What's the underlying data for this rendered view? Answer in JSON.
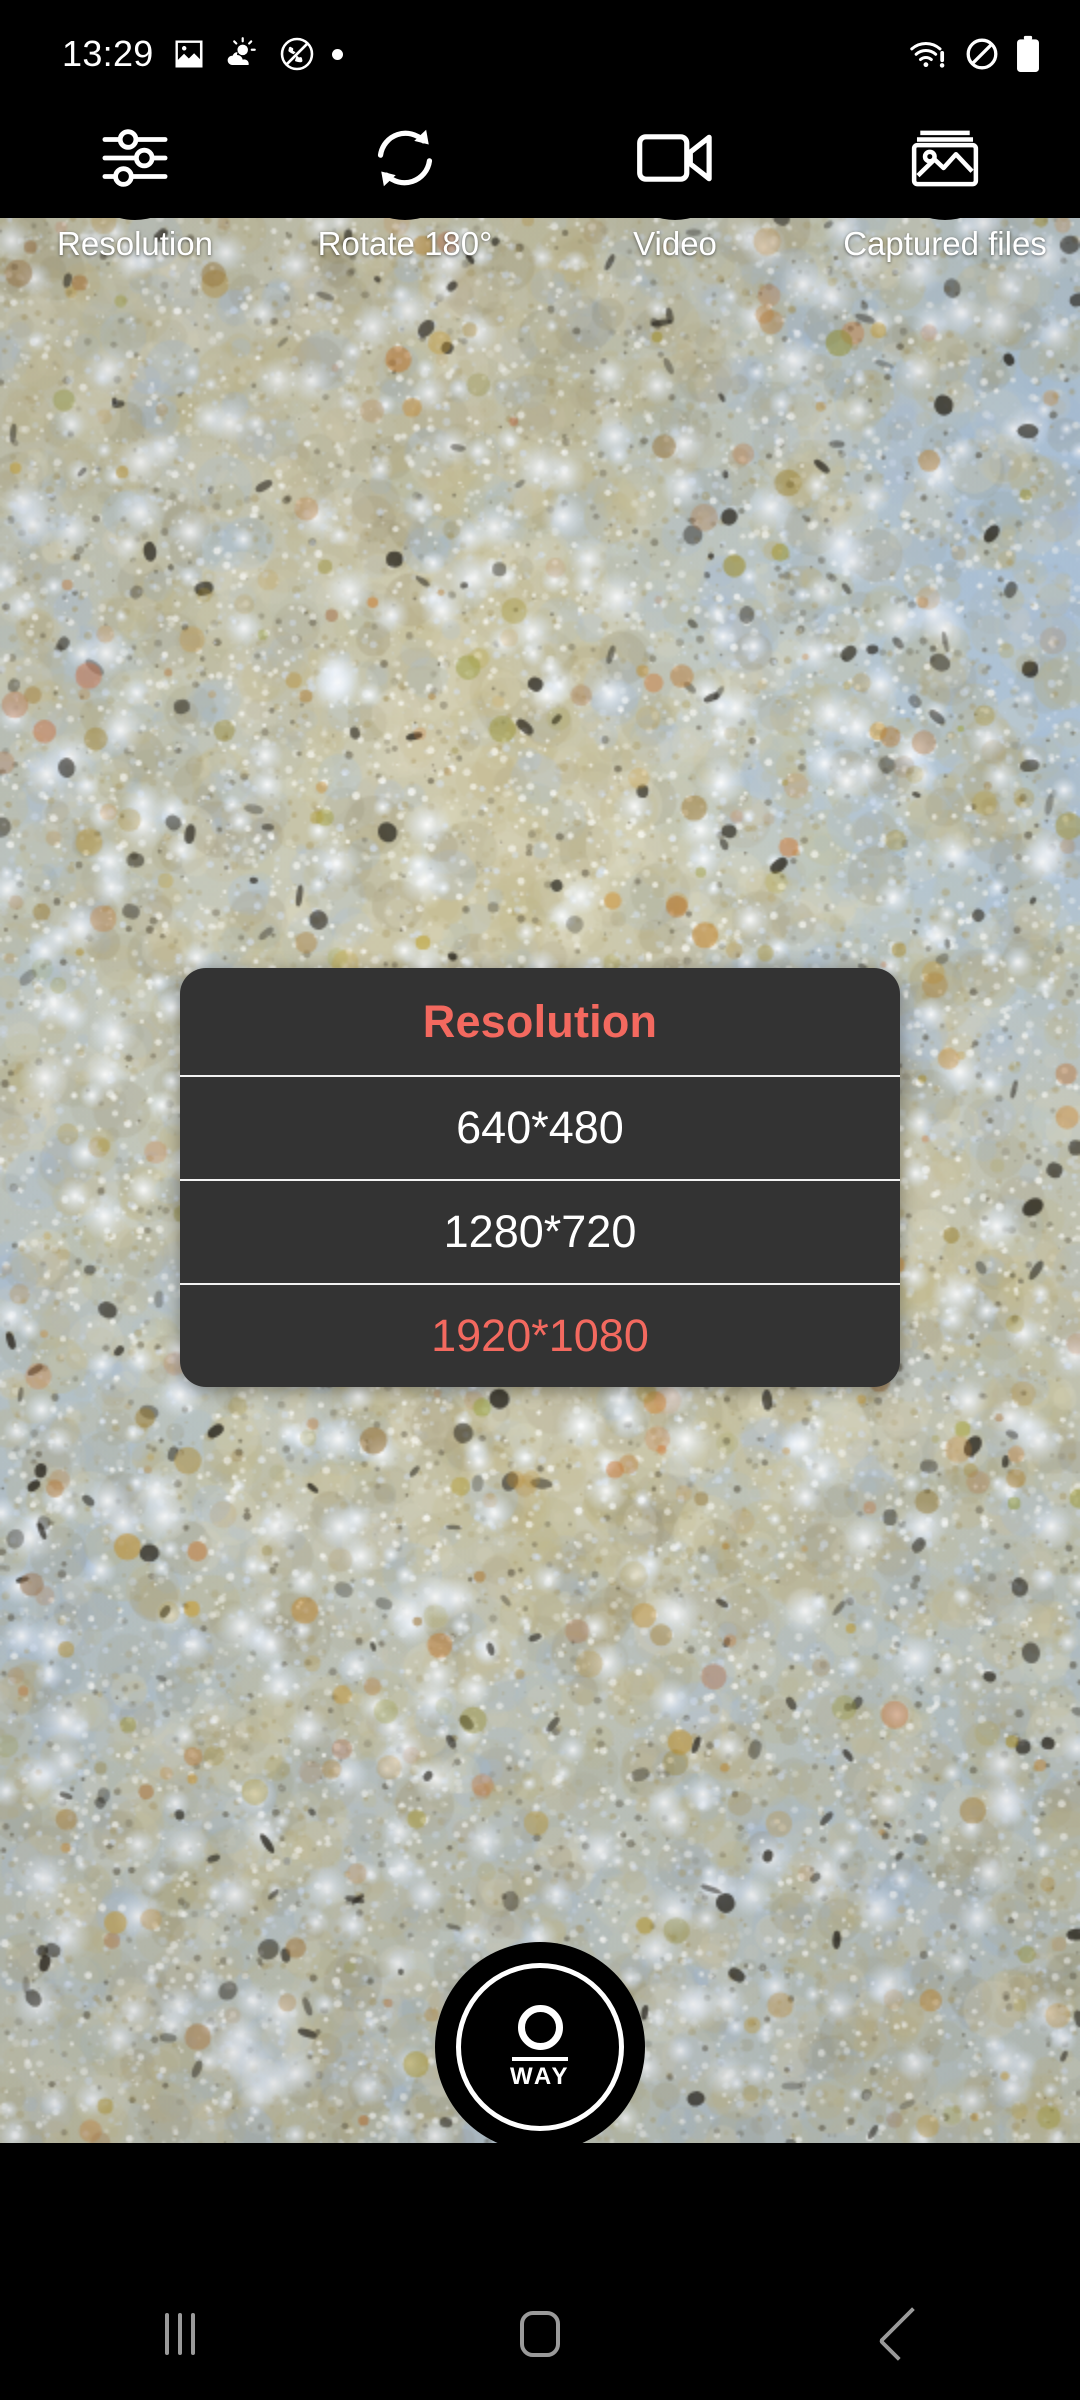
{
  "status_bar": {
    "clock": "13:29",
    "left_icons": [
      {
        "name": "gallery-image-icon",
        "glyph": "image"
      },
      {
        "name": "weather-partly-cloudy-icon",
        "glyph": "weather"
      },
      {
        "name": "call-blocked-icon",
        "glyph": "no-call"
      },
      {
        "name": "notification-dot-icon",
        "glyph": "dot"
      }
    ],
    "right_icons": [
      {
        "name": "wifi-no-internet-icon",
        "glyph": "wifi-alert"
      },
      {
        "name": "do-not-disturb-icon",
        "glyph": "dnd"
      },
      {
        "name": "battery-full-icon",
        "glyph": "battery"
      }
    ]
  },
  "toolbar": {
    "items": [
      {
        "label": "Resolution",
        "icon": "sliders-icon"
      },
      {
        "label": "Rotate 180°",
        "icon": "rotate-refresh-icon"
      },
      {
        "label": "Video",
        "icon": "video-camera-icon"
      },
      {
        "label": "Captured files",
        "icon": "photo-stack-icon"
      }
    ]
  },
  "dialog": {
    "title": "Resolution",
    "options": [
      {
        "label": "640*480",
        "selected": false
      },
      {
        "label": "1280*720",
        "selected": false
      },
      {
        "label": "1920*1080",
        "selected": true
      }
    ]
  },
  "shutter": {
    "brand_text": "WAY",
    "logo": "oway-logo-icon"
  },
  "nav_bar": {
    "recents_label": "recents-icon",
    "home_label": "home-icon",
    "back_label": "back-icon"
  },
  "colors": {
    "accent_red": "#f3695f",
    "dialog_bg": "#333333",
    "bar_black": "#000000",
    "nav_grey": "#9a9a9a",
    "text_white": "#ffffff"
  },
  "preview": {
    "description": "microscope-granular-surface"
  }
}
